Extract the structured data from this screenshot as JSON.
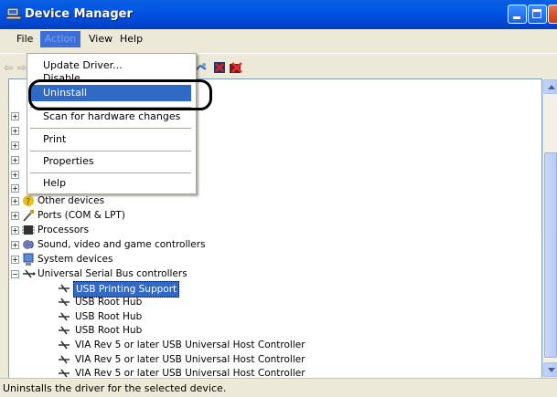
{
  "window": {
    "title": "Device Manager"
  },
  "menubar": {
    "file": "File",
    "action": "Action",
    "view": "View",
    "help": "Help"
  },
  "action_menu": {
    "update_driver": "Update Driver...",
    "disable": "Disable",
    "uninstall": "Uninstall",
    "scan": "Scan for hardware changes",
    "print": "Print",
    "properties": "Properties",
    "help": "Help"
  },
  "tree": {
    "items": [
      {
        "label": "Other devices",
        "icon": "other-devices-icon"
      },
      {
        "label": "Ports (COM & LPT)",
        "icon": "port-icon"
      },
      {
        "label": "Processors",
        "icon": "processor-icon"
      },
      {
        "label": "Sound, video and game controllers",
        "icon": "sound-icon"
      },
      {
        "label": "System devices",
        "icon": "system-devices-icon"
      },
      {
        "label": "Universal Serial Bus controllers",
        "icon": "usb-icon"
      }
    ],
    "usb_children": [
      "USB Printing Support",
      "USB Root Hub",
      "USB Root Hub",
      "USB Root Hub",
      "VIA Rev 5 or later USB Universal Host Controller",
      "VIA Rev 5 or later USB Universal Host Controller",
      "VIA Rev 5 or later USB Universal Host Controller"
    ],
    "selected": "USB Printing Support"
  },
  "status": {
    "text": "Uninstalls the driver for the selected device."
  },
  "colors": {
    "titlebar": "#0055e5",
    "selection": "#316ac5",
    "menu_active": "#3d6fd6"
  }
}
